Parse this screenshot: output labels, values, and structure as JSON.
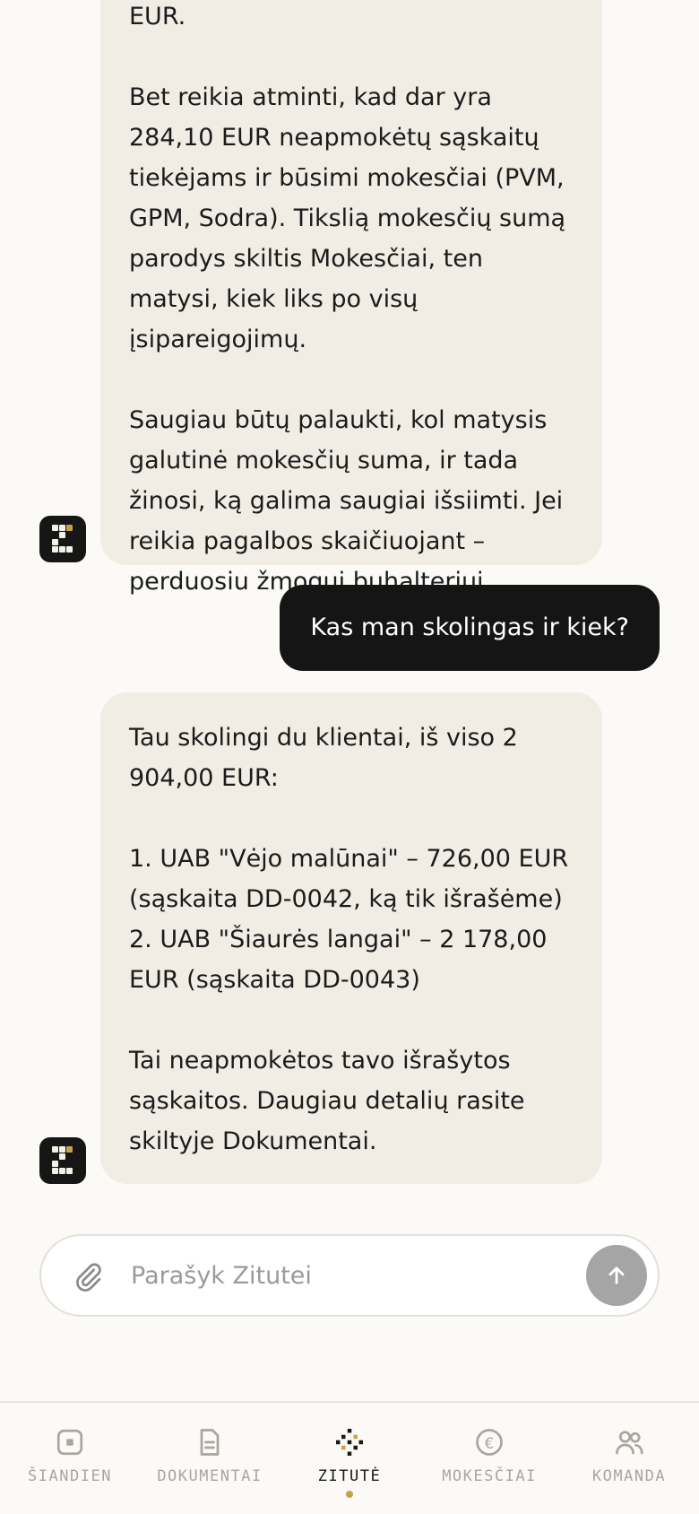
{
  "chat": {
    "messages": [
      {
        "role": "assistant",
        "paragraphs": [
          "EUR.",
          "Bet reikia atminti, kad dar yra 284,10 EUR neapmokėtų sąskaitų tiekėjams ir būsimi mokesčiai (PVM, GPM, Sodra). Tikslią mokesčių sumą parodys skiltis Mokesčiai, ten matysi, kiek liks po visų įsipareigojimų.",
          "Saugiau būtų palaukti, kol matysis galutinė mokesčių suma, ir tada žinosi, ką galima saugiai išsiimti. Jei reikia pagalbos skaičiuojant – perduosiu žmogui buhalteriui."
        ]
      },
      {
        "role": "user",
        "text": "Kas man skolingas ir kiek?"
      },
      {
        "role": "assistant",
        "intro": "Tau skolingi du klientai, iš viso 2 904,00 EUR:",
        "list": [
          "1. UAB \"Vėjo malūnai\" – 726,00 EUR (sąskaita DD-0042, ką tik išrašėme)",
          "2. UAB \"Šiaurės langai\" – 2 178,00 EUR (sąskaita DD-0043)"
        ],
        "outro": "Tai neapmokėtos tavo išrašytos sąskaitos. Daugiau detalių rasite skiltyje Dokumentai."
      }
    ]
  },
  "composer": {
    "placeholder": "Parašyk Zitutei",
    "attach_icon": "paperclip-icon",
    "send_icon": "arrow-up-icon"
  },
  "nav": {
    "items": [
      {
        "label": "ŠIANDIEN",
        "icon": "today-icon"
      },
      {
        "label": "DOKUMENTAI",
        "icon": "document-icon"
      },
      {
        "label": "ZITUTĖ",
        "icon": "zitute-logo-icon",
        "active": true
      },
      {
        "label": "MOKESČIAI",
        "icon": "euro-icon"
      },
      {
        "label": "KOMANDA",
        "icon": "team-icon"
      }
    ]
  },
  "colors": {
    "background": "#fbfaf7",
    "bot_bubble": "#f1ede5",
    "user_bubble": "#151515",
    "accent_gold": "#c8a04c"
  }
}
